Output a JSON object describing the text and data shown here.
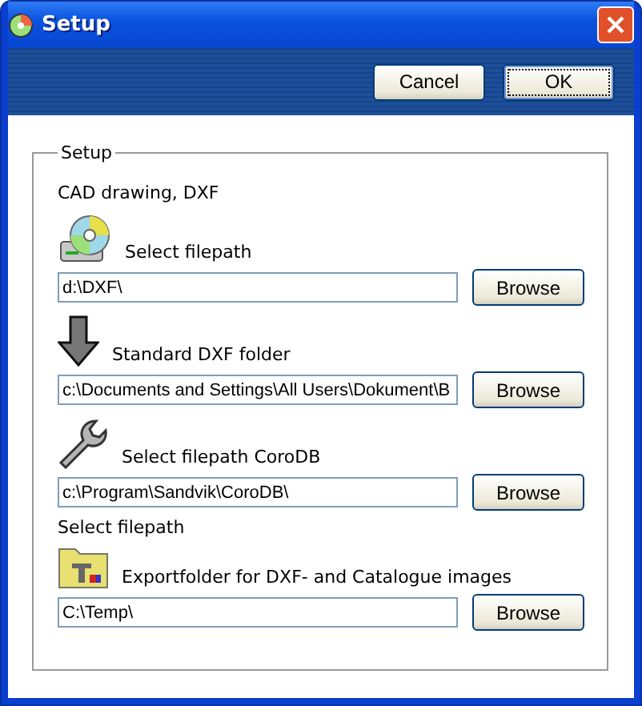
{
  "window": {
    "title": "Setup"
  },
  "toolbar": {
    "buttons": [
      {
        "label": "Cancel",
        "default": false
      },
      {
        "label": "OK",
        "default": true
      }
    ]
  },
  "group": {
    "title": "Setup",
    "heading": "CAD drawing, DXF",
    "sections": [
      {
        "kind": "disc",
        "label": "Select filepath",
        "value": "d:\\DXF\\",
        "button": "Browse"
      },
      {
        "kind": "arrow",
        "label": "Standard DXF folder",
        "value": "c:\\Documents and Settings\\All Users\\Dokument\\B",
        "button": "Browse"
      },
      {
        "kind": "wrench",
        "label": "Select filepath CoroDB",
        "value": "c:\\Program\\Sandvik\\CoroDB\\",
        "button": "Browse"
      },
      {
        "heading": "Select filepath",
        "kind": "toolbox",
        "label": "Exportfolder for DXF- and Catalogue images",
        "value": "C:\\Temp\\",
        "button": "Browse"
      }
    ]
  }
}
